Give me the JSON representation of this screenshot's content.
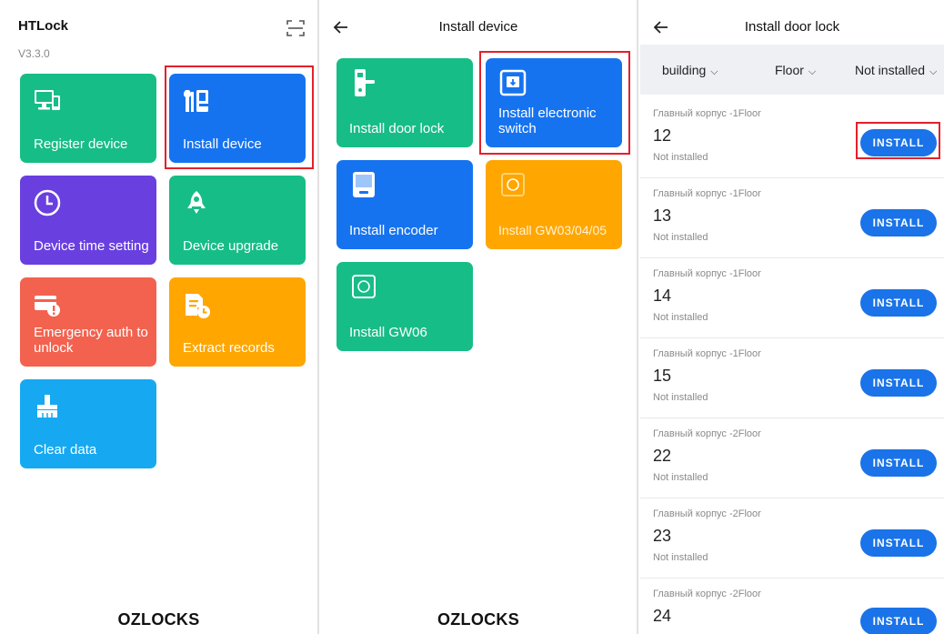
{
  "colors": {
    "green": "#17bd86",
    "blue": "#1673f0",
    "purple": "#6a3fe0",
    "red": "#f2624f",
    "orange": "#ffa600",
    "cyan": "#16a9f2",
    "highlight": "#e3202a",
    "install_btn": "#1a73e8"
  },
  "panel1": {
    "title": "HTLock",
    "version": "V3.3.0",
    "scan_icon": "scan-icon",
    "tiles": [
      {
        "label": "Register device",
        "icon": "monitor-icon",
        "color": "#17bd86"
      },
      {
        "label": "Install device",
        "icon": "tools-icon",
        "color": "#1673f0"
      },
      {
        "label": "Device time setting",
        "icon": "clock-icon",
        "color": "#6a3fe0"
      },
      {
        "label": "Device upgrade",
        "icon": "rocket-icon",
        "color": "#17bd86"
      },
      {
        "label": "Emergency auth to unlock",
        "icon": "card-alert-icon",
        "color": "#f2624f"
      },
      {
        "label": "Extract records",
        "icon": "records-icon",
        "color": "#ffa600"
      },
      {
        "label": "Clear data",
        "icon": "broom-icon",
        "color": "#16a9f2"
      }
    ],
    "brand": "OZLOCKS"
  },
  "panel2": {
    "title": "Install device",
    "tiles": [
      {
        "label": "Install door lock",
        "icon": "door-lock-icon",
        "color": "#17bd86"
      },
      {
        "label": "Install electronic switch",
        "icon": "switch-icon",
        "color": "#1673f0"
      },
      {
        "label": "Install encoder",
        "icon": "encoder-icon",
        "color": "#1673f0"
      },
      {
        "label": "Install GW03/04/05",
        "icon": "gateway-icon",
        "color": "#ffa600"
      },
      {
        "label": "Install GW06",
        "icon": "gateway-icon",
        "color": "#17bd86"
      }
    ],
    "brand": "OZLOCKS"
  },
  "panel3": {
    "title": "Install door lock",
    "filters": {
      "building": "building",
      "floor": "Floor",
      "status": "Not installed"
    },
    "rows": [
      {
        "building": "Главный корпус -1Floor",
        "room": "12",
        "status": "Not installed",
        "button": "INSTALL"
      },
      {
        "building": "Главный корпус -1Floor",
        "room": "13",
        "status": "Not installed",
        "button": "INSTALL"
      },
      {
        "building": "Главный корпус -1Floor",
        "room": "14",
        "status": "Not installed",
        "button": "INSTALL"
      },
      {
        "building": "Главный корпус -1Floor",
        "room": "15",
        "status": "Not installed",
        "button": "INSTALL"
      },
      {
        "building": "Главный корпус -2Floor",
        "room": "22",
        "status": "Not installed",
        "button": "INSTALL"
      },
      {
        "building": "Главный корпус -2Floor",
        "room": "23",
        "status": "Not installed",
        "button": "INSTALL"
      },
      {
        "building": "Главный корпус -2Floor",
        "room": "24",
        "status": "",
        "button": "INSTALL"
      }
    ]
  }
}
